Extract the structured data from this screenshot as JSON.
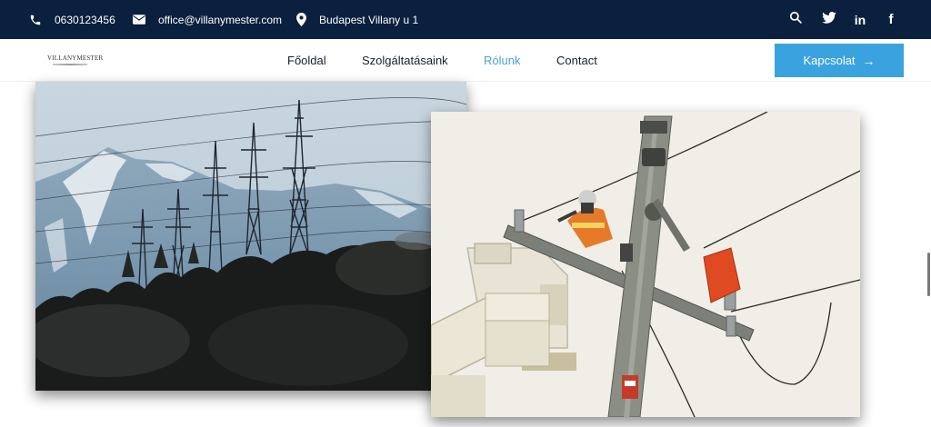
{
  "topbar": {
    "phone": "0630123456",
    "email": "office@villanymester.com",
    "address": "Budapest Villany u 1",
    "icons": [
      "phone-icon",
      "mail-icon",
      "location-icon",
      "search-icon",
      "twitter-icon",
      "linkedin-icon",
      "facebook-icon"
    ]
  },
  "nav": {
    "logo_text": "VILLANYMESTER",
    "links": [
      "Főoldal",
      "Szolgáltatásaink",
      "Rólunk",
      "Contact"
    ],
    "active": "Rólunk",
    "cta_label": "Kapcsolat",
    "cta_icon": "arrow-right-icon"
  },
  "colors": {
    "topbar_bg": "#0b1f3e",
    "accent": "#3aa3df",
    "active_link": "#4aa3d4"
  }
}
